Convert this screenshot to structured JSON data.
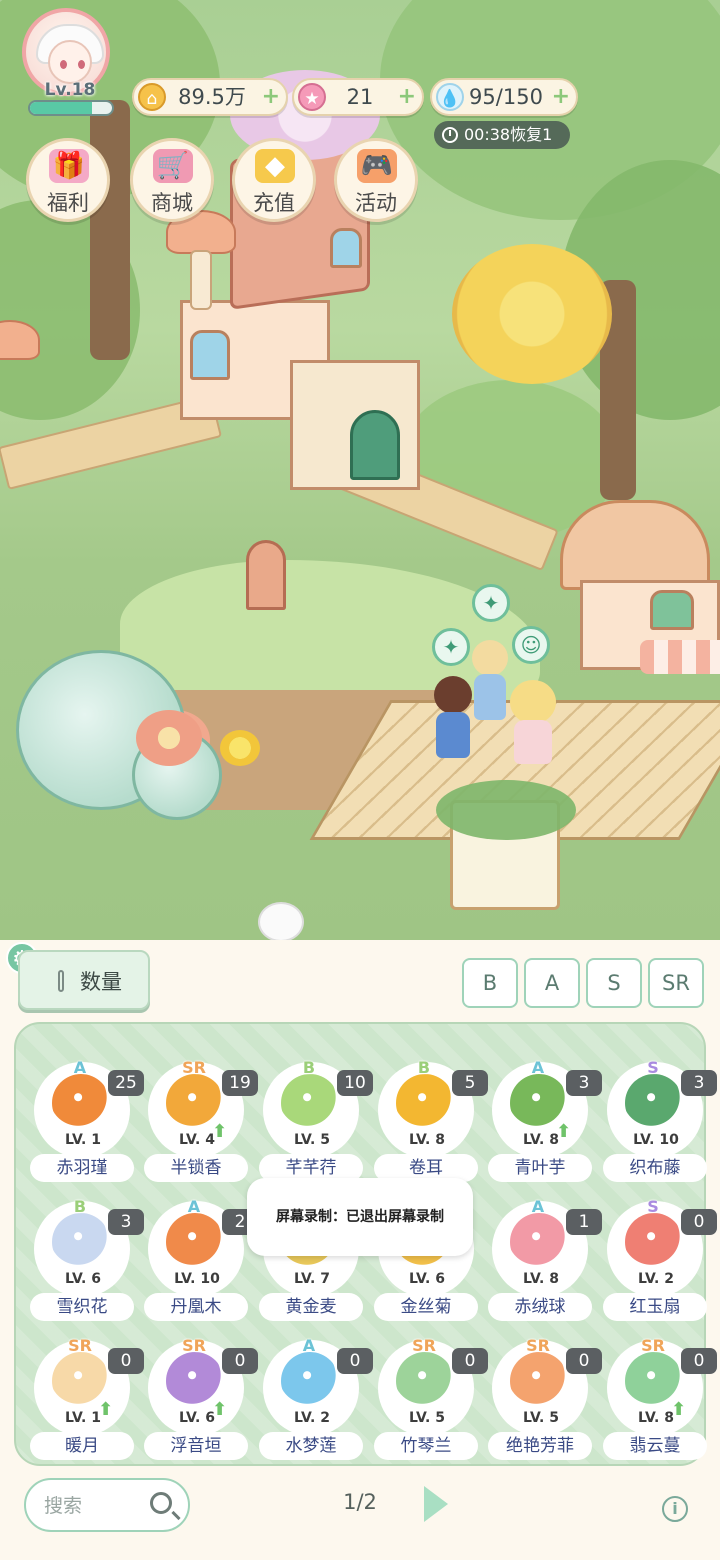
{
  "player": {
    "level": "Lv.18",
    "xp_fraction": 0.75
  },
  "resources": [
    {
      "icon": "coin-icon",
      "value": "89.5万"
    },
    {
      "icon": "star-gem-icon",
      "value": "21"
    },
    {
      "icon": "water-drop-icon",
      "value": "95/150"
    }
  ],
  "timer": "00:38恢复1",
  "menu": [
    {
      "icon": "gift-icon",
      "label": "福利"
    },
    {
      "icon": "shop-cart-icon",
      "label": "商城"
    },
    {
      "icon": "diamond-icon",
      "label": "充值"
    },
    {
      "icon": "gamepad-icon",
      "label": "活动"
    }
  ],
  "sort_label": "数量",
  "filters": [
    "B",
    "A",
    "S",
    "SR"
  ],
  "colors": {
    "B": "#9bcf79",
    "A": "#6cc3d6",
    "S": "#a98be0",
    "SR": "#f0a55a"
  },
  "plants": [
    {
      "rarity": "A",
      "count": "25",
      "level": "LV. 1",
      "name": "赤羽瑾",
      "color": "#f08a3a",
      "upgrade": false
    },
    {
      "rarity": "SR",
      "count": "19",
      "level": "LV. 4",
      "name": "半锁香",
      "color": "#f2a83a",
      "upgrade": true
    },
    {
      "rarity": "B",
      "count": "10",
      "level": "LV. 5",
      "name": "芊芊荇",
      "color": "#a9d87a",
      "upgrade": false
    },
    {
      "rarity": "B",
      "count": "5",
      "level": "LV. 8",
      "name": "卷耳",
      "color": "#f3b731",
      "upgrade": false
    },
    {
      "rarity": "A",
      "count": "3",
      "level": "LV. 8",
      "name": "青叶芋",
      "color": "#78b85a",
      "upgrade": true
    },
    {
      "rarity": "S",
      "count": "3",
      "level": "LV. 10",
      "name": "织布藤",
      "color": "#5aa86e",
      "upgrade": false
    },
    {
      "rarity": "B",
      "count": "3",
      "level": "LV. 6",
      "name": "雪织花",
      "color": "#c9d8f0",
      "upgrade": false
    },
    {
      "rarity": "A",
      "count": "2",
      "level": "LV. 10",
      "name": "丹凰木",
      "color": "#f08a4a",
      "upgrade": false
    },
    {
      "rarity": "",
      "count": "",
      "level": "LV. 7",
      "name": "黄金麦",
      "color": "#e8c85a",
      "upgrade": false
    },
    {
      "rarity": "",
      "count": "",
      "level": "LV. 6",
      "name": "金丝菊",
      "color": "#f2c04a",
      "upgrade": false
    },
    {
      "rarity": "A",
      "count": "1",
      "level": "LV. 8",
      "name": "赤绒球",
      "color": "#f29aa6",
      "upgrade": false
    },
    {
      "rarity": "S",
      "count": "0",
      "level": "LV. 2",
      "name": "红玉扇",
      "color": "#ef7f73",
      "upgrade": false
    },
    {
      "rarity": "SR",
      "count": "0",
      "level": "LV. 1",
      "name": "暖月",
      "color": "#f7d9a8",
      "upgrade": true
    },
    {
      "rarity": "SR",
      "count": "0",
      "level": "LV. 6",
      "name": "浮音垣",
      "color": "#b28ad8",
      "upgrade": true
    },
    {
      "rarity": "A",
      "count": "0",
      "level": "LV. 2",
      "name": "水梦莲",
      "color": "#7cc7ec",
      "upgrade": false
    },
    {
      "rarity": "SR",
      "count": "0",
      "level": "LV. 5",
      "name": "竹琴兰",
      "color": "#9dd39a",
      "upgrade": false
    },
    {
      "rarity": "SR",
      "count": "0",
      "level": "LV. 5",
      "name": "绝艳芳菲",
      "color": "#f4a36e",
      "upgrade": false
    },
    {
      "rarity": "SR",
      "count": "0",
      "level": "LV. 8",
      "name": "翡云蔓",
      "color": "#8fd19a",
      "upgrade": true
    }
  ],
  "toast": "屏幕录制：已退出屏幕录制",
  "search_placeholder": "搜索",
  "page": "1/2"
}
